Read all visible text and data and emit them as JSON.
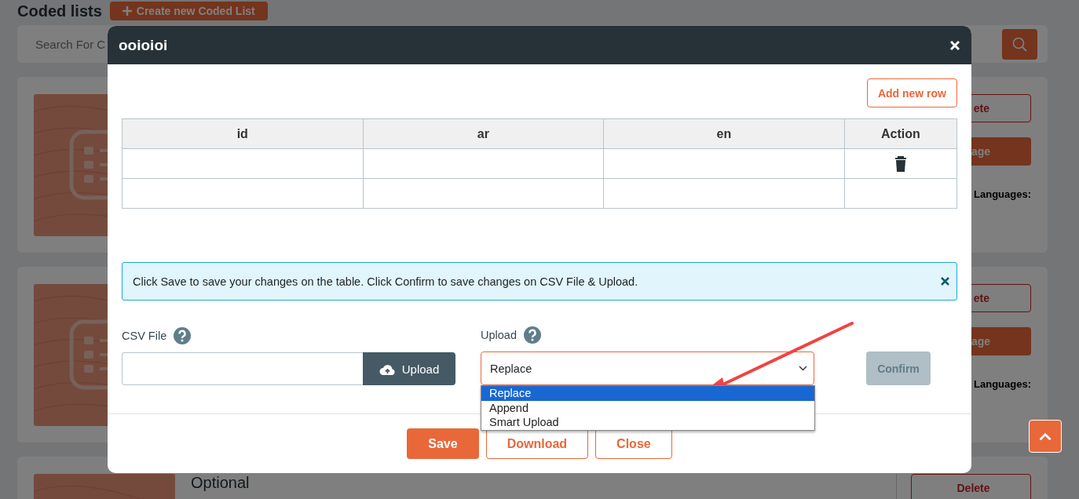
{
  "page": {
    "title": "Coded lists",
    "create_button": "Create new Coded List",
    "search": {
      "placeholder": "Search For C"
    },
    "cards": [
      {
        "delete_button": "ete",
        "manage_button": "age",
        "languages_label": "Languages:"
      },
      {
        "delete_button": "ete",
        "manage_button": "age",
        "languages_label": "Languages:"
      },
      {
        "title": "Optional",
        "delete_button": "Delete"
      }
    ]
  },
  "modal": {
    "title": "ooioioi",
    "add_row_button": "Add new row",
    "table": {
      "columns": [
        "id",
        "ar",
        "en",
        "Action"
      ],
      "rows": [
        {
          "cells": [
            "",
            "",
            ""
          ],
          "deletable": true
        },
        {
          "cells": [
            "",
            "",
            ""
          ],
          "deletable": false
        }
      ]
    },
    "alert": {
      "text": "Click Save to save your changes on the table. Click Confirm to save changes on CSV File & Upload."
    },
    "csv_file": {
      "label": "CSV File",
      "upload_button": "Upload"
    },
    "upload_mode": {
      "label": "Upload",
      "value": "Replace",
      "open": true,
      "options": [
        {
          "label": "Replace",
          "selected": true
        },
        {
          "label": "Append",
          "selected": false
        },
        {
          "label": "Smart Upload",
          "selected": false
        }
      ]
    },
    "confirm_button": {
      "label": "Confirm",
      "disabled": true
    },
    "footer_buttons": [
      {
        "label": "Save",
        "kind": "primary"
      },
      {
        "label": "Download",
        "kind": "outline"
      },
      {
        "label": "Close",
        "kind": "outline"
      }
    ]
  }
}
